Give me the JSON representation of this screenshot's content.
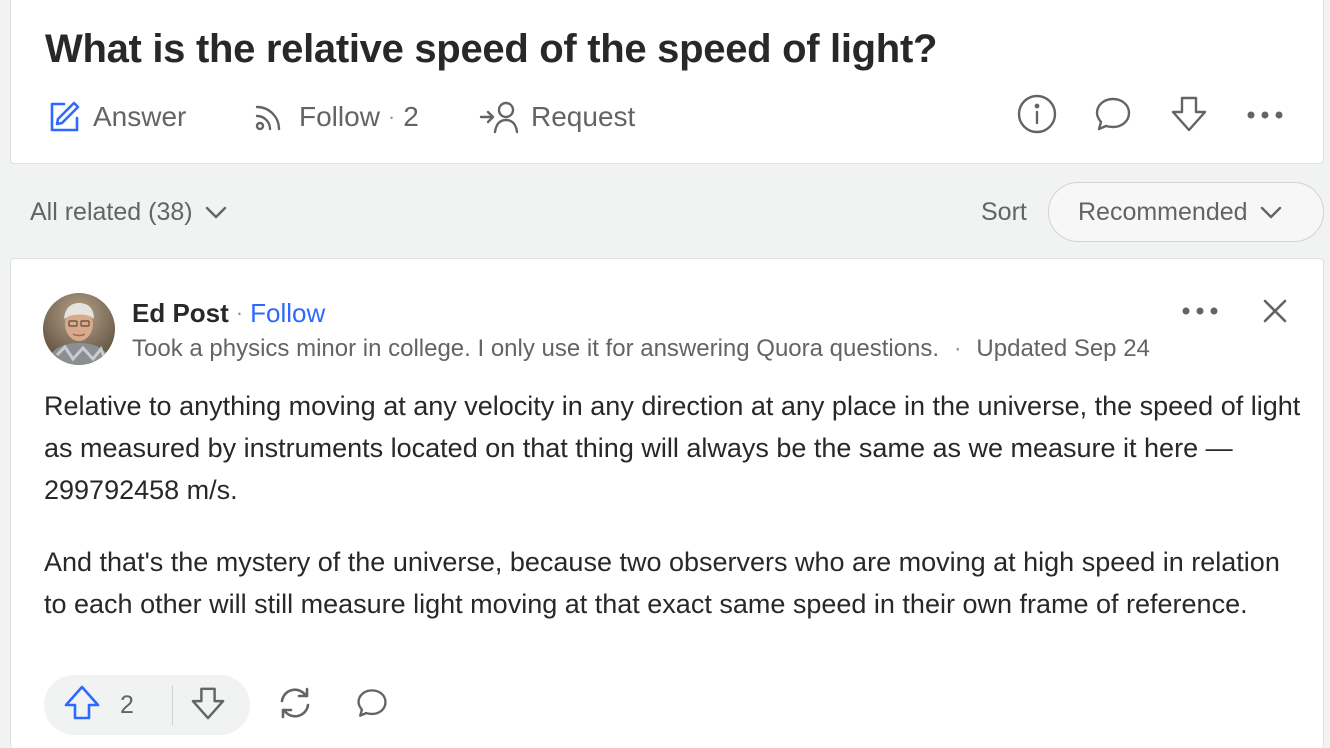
{
  "question": {
    "title": "What is the relative speed of the speed of light?",
    "actions": {
      "answer_label": "Answer",
      "follow_label": "Follow",
      "follow_count": "2",
      "request_label": "Request"
    },
    "icons": [
      "info-icon",
      "comment-icon",
      "downvote-icon",
      "more-icon"
    ]
  },
  "filters": {
    "all_related_label": "All related (38)",
    "sort_label": "Sort",
    "sort_selected": "Recommended"
  },
  "answer": {
    "author_name": "Ed Post",
    "follow_label": "Follow",
    "credential": "Took a physics minor in college. I only use it for answering Quora questions.",
    "updated": "Updated Sep 24",
    "paragraphs": [
      "Relative to anything moving at any velocity in any direction at any place in the universe, the speed of light as measured by instruments located on that thing will always be the same as we measure it here — 299792458 m/s.",
      "And that's the mystery of the universe, because two observers who are moving at high speed in relation to each other will still measure light moving at that exact same speed in their own frame of reference."
    ],
    "upvote_count": "2"
  },
  "colors": {
    "accent_blue": "#2e69ff",
    "text_primary": "#282829",
    "text_secondary": "#636466",
    "page_background": "#f1f2f2",
    "card_background": "#ffffff"
  }
}
